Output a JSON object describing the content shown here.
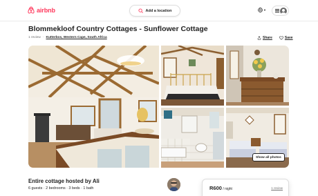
{
  "header": {
    "logo_text": "airbnb",
    "search_label": "Add a location",
    "brand_color": "#ff385c",
    "icons": [
      "airbnb-logo",
      "search-icon",
      "globe-icon",
      "hamburger-icon",
      "user-avatar-icon"
    ]
  },
  "listing": {
    "title": "Blommekloof Country Cottages - Sunflower Cottage",
    "reviews": "1 review",
    "separator": "·",
    "location": "Kutterbos, Western Cape, South Africa"
  },
  "actions": {
    "share": "Share",
    "save": "Save"
  },
  "gallery": {
    "photos": [
      "main-room",
      "bedroom-brass-bed",
      "dresser-flowers",
      "bathroom-tub",
      "twin-bedroom"
    ],
    "show_all_label": "Show all photos"
  },
  "host": {
    "title": "Entire cottage hosted by Ali",
    "details": "6 guests · 2 bedrooms · 3 beds · 1 bath"
  },
  "booking": {
    "price": "R600",
    "per_night": " / night",
    "reviews": "1 review"
  }
}
